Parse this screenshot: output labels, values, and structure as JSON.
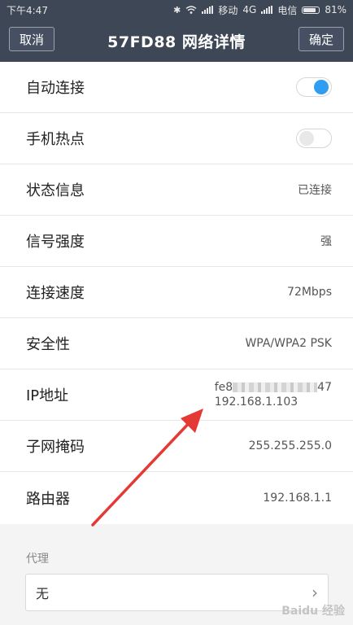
{
  "status_bar": {
    "time": "下午4:47",
    "carrier1": "移动",
    "network": "4G",
    "carrier2": "电信",
    "battery": "81%",
    "battery_level": 0.81
  },
  "title_bar": {
    "cancel_label": "取消",
    "title": "57FD88  网络详情",
    "ok_label": "确定"
  },
  "rows": [
    {
      "label": "自动连接",
      "toggle": "on"
    },
    {
      "label": "手机热点",
      "toggle": "off"
    },
    {
      "label": "状态信息",
      "value": "已连接"
    },
    {
      "label": "信号强度",
      "value": "强"
    },
    {
      "label": "连接速度",
      "value": "72Mbps"
    },
    {
      "label": "安全性",
      "value": "WPA/WPA2 PSK"
    },
    {
      "label": "IP地址",
      "value_v6_start": "fe8",
      "value_v6_end": "47",
      "value_v4": "192.168.1.103"
    },
    {
      "label": "子网掩码",
      "value": "255.255.255.0"
    },
    {
      "label": "路由器",
      "value": "192.168.1.1"
    }
  ],
  "proxy": {
    "section_label": "代理",
    "value": "无"
  },
  "watermark": "Baidu 经验",
  "colors": {
    "header_bg": "#3e4755",
    "toggle_on": "#2e9df2",
    "arrow": "#e53935"
  }
}
